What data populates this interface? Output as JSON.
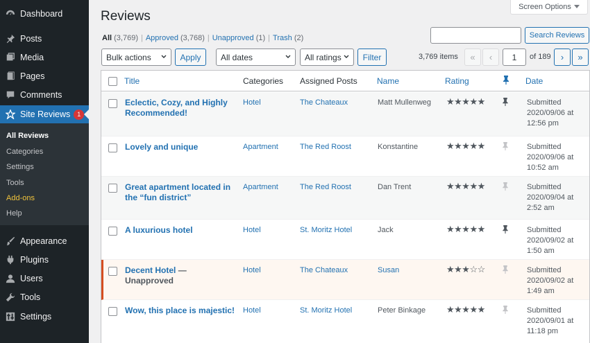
{
  "sidebar": {
    "top_items": [
      {
        "label": "Dashboard",
        "icon": "dashboard-icon"
      },
      {
        "label": "Posts",
        "icon": "pushpin-icon"
      },
      {
        "label": "Media",
        "icon": "media-icon"
      },
      {
        "label": "Pages",
        "icon": "pages-icon"
      },
      {
        "label": "Comments",
        "icon": "comments-icon"
      },
      {
        "label": "Site Reviews",
        "icon": "star-icon",
        "badge": "1"
      }
    ],
    "submenu": [
      "All Reviews",
      "Categories",
      "Settings",
      "Tools",
      "Add-ons",
      "Help"
    ],
    "bottom_items": [
      {
        "label": "Appearance",
        "icon": "paintbrush-icon"
      },
      {
        "label": "Plugins",
        "icon": "plugin-icon"
      },
      {
        "label": "Users",
        "icon": "users-icon"
      },
      {
        "label": "Tools",
        "icon": "wrench-icon"
      },
      {
        "label": "Settings",
        "icon": "settings-icon"
      }
    ]
  },
  "header": {
    "title": "Reviews",
    "screen_options": "Screen Options"
  },
  "views": {
    "all": "All",
    "all_count": "(3,769)",
    "approved": "Approved",
    "approved_count": "(3,768)",
    "unapproved": "Unapproved",
    "unapproved_count": "(1)",
    "trash": "Trash",
    "trash_count": "(2)",
    "sep": "|"
  },
  "search": {
    "button": "Search Reviews",
    "value": ""
  },
  "toolbar": {
    "bulk_actions": "Bulk actions",
    "apply": "Apply",
    "dates": "All dates",
    "ratings": "All ratings",
    "filter": "Filter"
  },
  "pagination": {
    "items": "3,769 items",
    "first": "«",
    "prev": "‹",
    "current_page": "1",
    "of_pages": "of 189",
    "next": "›",
    "last": "»"
  },
  "table": {
    "headers": {
      "title": "Title",
      "categories": "Categories",
      "assigned": "Assigned Posts",
      "name": "Name",
      "rating": "Rating",
      "date": "Date"
    },
    "rows": [
      {
        "title": "Eclectic, Cozy, and Highly Recommended!",
        "state": "",
        "category": "Hotel",
        "assigned": "The Chateaux",
        "name": "Matt Mullenweg",
        "stars": "★★★★★",
        "pinned": true,
        "date1": "Submitted",
        "date2": "2020/09/06 at",
        "date3": "12:56 pm"
      },
      {
        "title": "Lovely and unique",
        "state": "",
        "category": "Apartment",
        "assigned": "The Red Roost",
        "name": "Konstantine",
        "stars": "★★★★★",
        "pinned": false,
        "date1": "Submitted",
        "date2": "2020/09/06 at",
        "date3": "10:52 am"
      },
      {
        "title": "Great apartment located in the “fun district”",
        "state": "",
        "category": "Apartment",
        "assigned": "The Red Roost",
        "name": "Dan Trent",
        "stars": "★★★★★",
        "pinned": false,
        "date1": "Submitted",
        "date2": "2020/09/04 at",
        "date3": "2:52 am"
      },
      {
        "title": "A luxurious hotel",
        "state": "",
        "category": "Hotel",
        "assigned": "St. Moritz Hotel",
        "name": "Jack",
        "stars": "★★★★★",
        "pinned": true,
        "date1": "Submitted",
        "date2": "2020/09/02 at",
        "date3": "1:50 am"
      },
      {
        "title": "Decent Hotel",
        "state": " — Unapproved",
        "category": "Hotel",
        "assigned": "The Chateaux",
        "name": "Susan",
        "stars": "★★★☆☆",
        "pinned": false,
        "date1": "Submitted",
        "date2": "2020/09/02 at",
        "date3": "1:49 am"
      },
      {
        "title": "Wow, this place is majestic!",
        "state": "",
        "category": "Hotel",
        "assigned": "St. Moritz Hotel",
        "name": "Peter Binkage",
        "stars": "★★★★★",
        "pinned": false,
        "date1": "Submitted",
        "date2": "2020/09/01 at",
        "date3": "11:18 pm"
      }
    ]
  },
  "colors": {
    "sidebar_bg": "#1d2327",
    "accent": "#2271b1",
    "unapproved_border": "#d54e21",
    "badge": "#d63638"
  }
}
